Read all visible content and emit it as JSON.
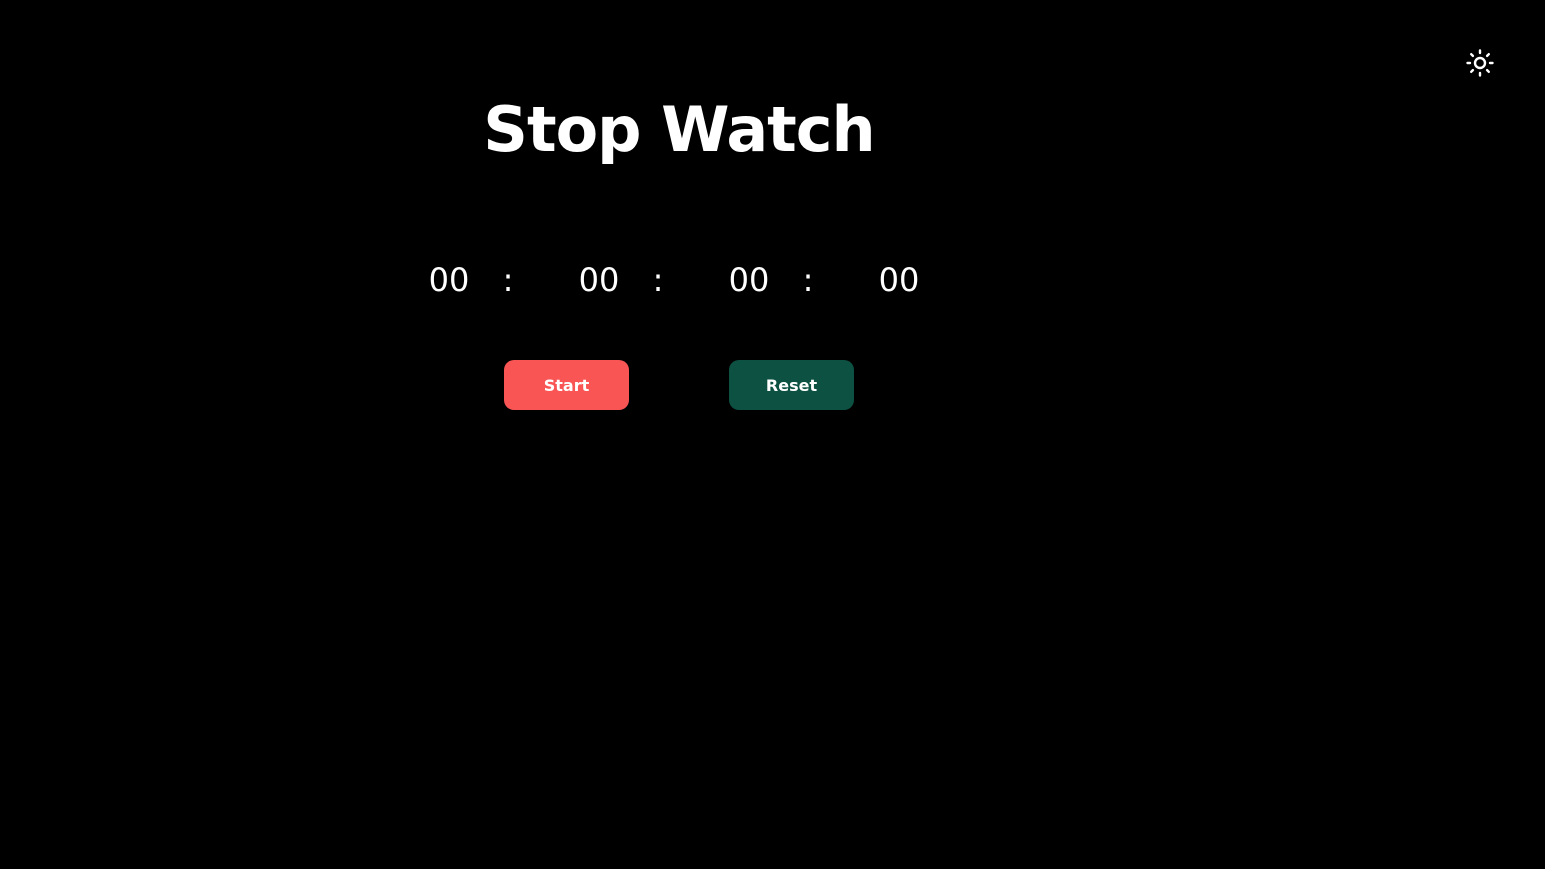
{
  "header": {
    "title": "Stop Watch",
    "theme_icon": "sun-icon"
  },
  "timer": {
    "hours": "00",
    "minutes": "00",
    "seconds": "00",
    "centiseconds": "00",
    "separator": ":"
  },
  "controls": {
    "start_label": "Start",
    "reset_label": "Reset"
  },
  "colors": {
    "background": "#000000",
    "text": "#ffffff",
    "start_button": "#f95555",
    "reset_button": "#0d5143"
  }
}
